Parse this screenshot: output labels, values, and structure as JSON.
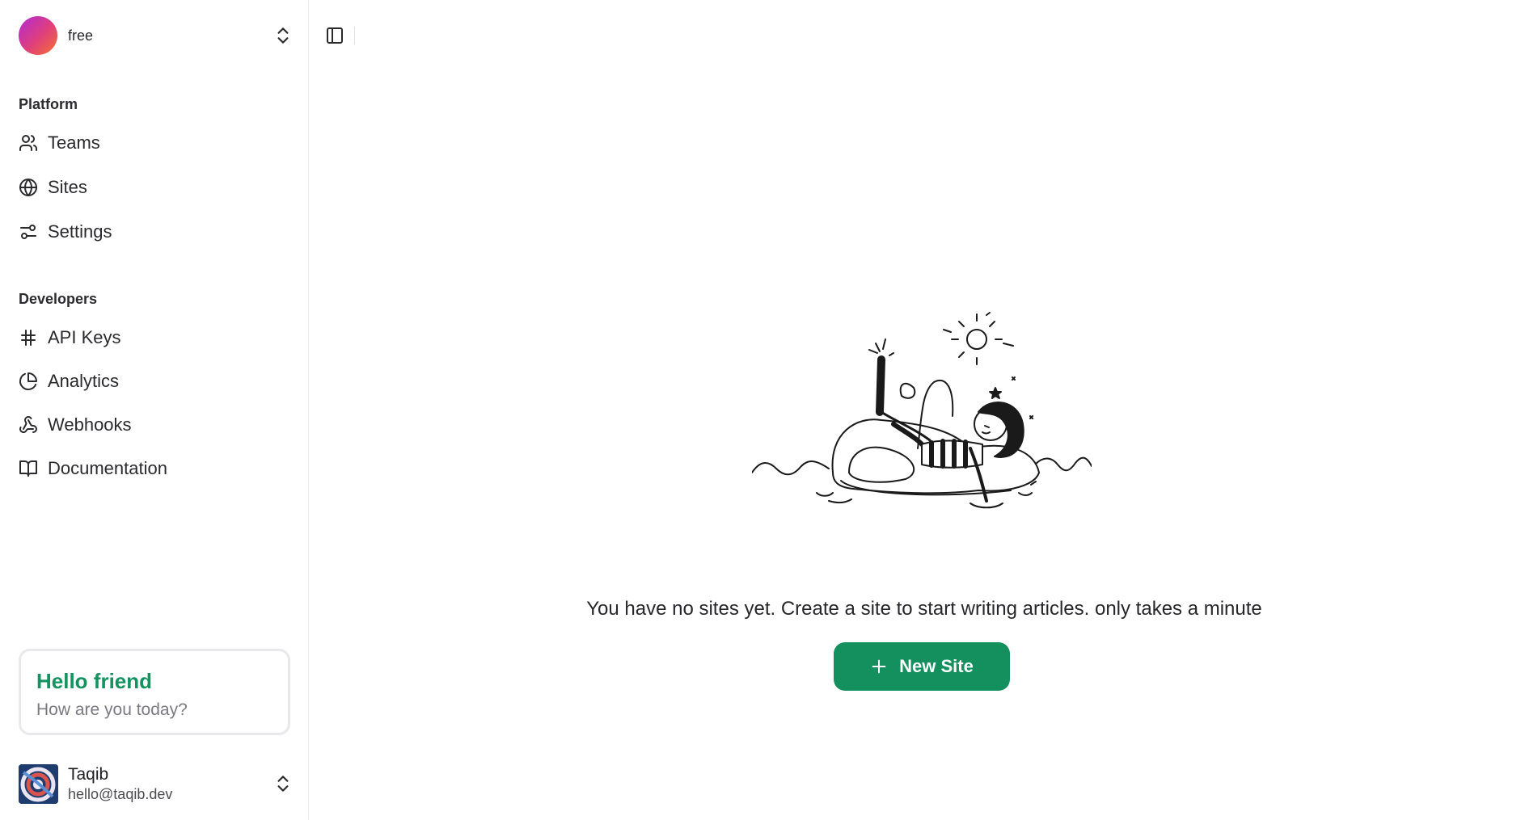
{
  "team": {
    "name": "free",
    "logo_gradient": [
      "#b12ad6",
      "#e0407a",
      "#f5722d"
    ]
  },
  "platform": {
    "label": "Platform",
    "items": [
      {
        "label": "Teams",
        "icon": "users-icon"
      },
      {
        "label": "Sites",
        "icon": "globe-icon"
      },
      {
        "label": "Settings",
        "icon": "sliders-icon"
      }
    ]
  },
  "developers": {
    "label": "Developers",
    "items": [
      {
        "label": "API Keys",
        "icon": "hash-icon"
      },
      {
        "label": "Analytics",
        "icon": "pie-chart-icon"
      },
      {
        "label": "Webhooks",
        "icon": "webhook-icon"
      },
      {
        "label": "Documentation",
        "icon": "book-open-icon"
      }
    ]
  },
  "card": {
    "title": "Hello friend",
    "subtitle": "How are you today?"
  },
  "user": {
    "name": "Taqib",
    "email": "hello@taqib.dev"
  },
  "main": {
    "empty_message": "You have no sites yet. Create a site to start writing articles. only takes a minute",
    "new_site_label": "New Site"
  },
  "colors": {
    "accent": "#13905e",
    "accent_text": "#14925f",
    "border": "#ececee"
  }
}
